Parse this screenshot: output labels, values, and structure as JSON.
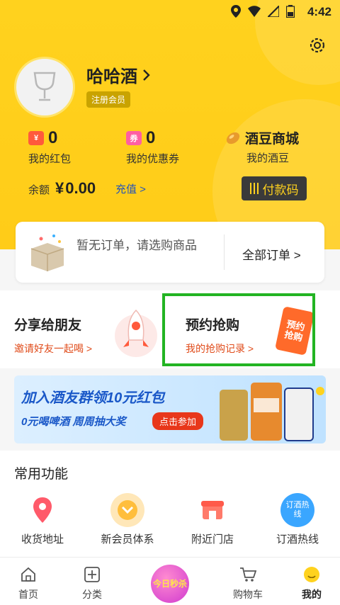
{
  "status": {
    "time": "4:42"
  },
  "profile": {
    "username": "哈哈酒",
    "member_badge": "注册会员"
  },
  "stats": {
    "red_packet": {
      "value": "0",
      "label": "我的红包",
      "icon": "¥"
    },
    "coupon": {
      "value": "0",
      "label": "我的优惠券",
      "icon": "券"
    },
    "bean_mall": {
      "title": "酒豆商城",
      "label": "我的酒豆"
    }
  },
  "balance": {
    "label": "余额",
    "currency": "¥",
    "amount": "0.00",
    "recharge": "充值 >"
  },
  "paycode": {
    "label": "付款码"
  },
  "orders": {
    "empty_text": "暂无订单，请选购商品",
    "all_orders": "全部订单 >"
  },
  "promos": {
    "share": {
      "title": "分享给朋友",
      "sub": "邀请好友一起喝 >"
    },
    "reserve": {
      "title": "预约抢购",
      "sub": "我的抢购记录 >",
      "card_text": "预约抢购"
    }
  },
  "banner": {
    "title": "加入酒友群领10元红包",
    "sub": "0元喝啤酒 周周抽大奖",
    "button": "点击参加"
  },
  "common": {
    "title": "常用功能",
    "items": [
      {
        "label": "收货地址",
        "icon": "location-pin-icon"
      },
      {
        "label": "新会员体系",
        "icon": "member-chevron-icon"
      },
      {
        "label": "附近门店",
        "icon": "store-icon"
      },
      {
        "label": "订酒热线",
        "icon": "hotline-icon",
        "icon_text": "订酒热线"
      }
    ]
  },
  "tabs": [
    {
      "label": "首页",
      "icon": "home-icon"
    },
    {
      "label": "分类",
      "icon": "category-icon"
    },
    {
      "label": "今日秒杀",
      "icon": "flash-sale-icon"
    },
    {
      "label": "购物车",
      "icon": "cart-icon"
    },
    {
      "label": "我的",
      "icon": "mine-icon",
      "active": true
    }
  ],
  "colors": {
    "brand_yellow": "#ffd21e",
    "accent_red": "#e04b1a",
    "link_blue": "#2554b8",
    "highlight_green": "#22b422"
  }
}
